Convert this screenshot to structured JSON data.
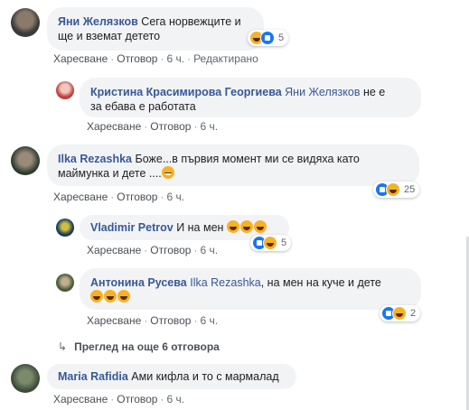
{
  "comments": [
    {
      "name": "Яни Желязков",
      "text": "Сега норвежците и ще и вземат детето",
      "reactions": "5",
      "like": "Харесване",
      "reply": "Отговор",
      "time": "6 ч.",
      "edited": "Редактирано"
    },
    {
      "name": "Кристина Красимирова Георгиева",
      "mention": "Яни Желязков",
      "text_line1": " не е",
      "text_line2": "за ебава е работата",
      "like": "Харесване",
      "reply": "Отговор",
      "time": "6 ч."
    },
    {
      "name": "Ilka Rezashka",
      "text_line1": "Боже...в първия момент ми се видяха като",
      "text_line2": "маймунка и дете ....",
      "reactions": "25",
      "like": "Харесване",
      "reply": "Отговор",
      "time": "6 ч."
    },
    {
      "name": "Vladimir Petrov",
      "text": "И на мен",
      "reactions": "5",
      "like": "Харесване",
      "reply": "Отговор",
      "time": "6 ч."
    },
    {
      "name": "Антонина Русева",
      "mention": "Ilka Rezashka",
      "text": ", на мен на куче и дете",
      "reactions": "2",
      "like": "Харесване",
      "reply": "Отговор",
      "time": "6 ч."
    },
    {
      "name": "Maria Rafidia",
      "text": "Ами кифла и то с мармалад",
      "like": "Харесване",
      "reply": "Отговор",
      "time": "6 ч."
    }
  ],
  "view_more": "Преглед на още 6 отговора",
  "colors": {
    "name": "#385898",
    "bubble": "#f2f3f5",
    "like": "#1877f2",
    "haha": "#f7b125"
  }
}
